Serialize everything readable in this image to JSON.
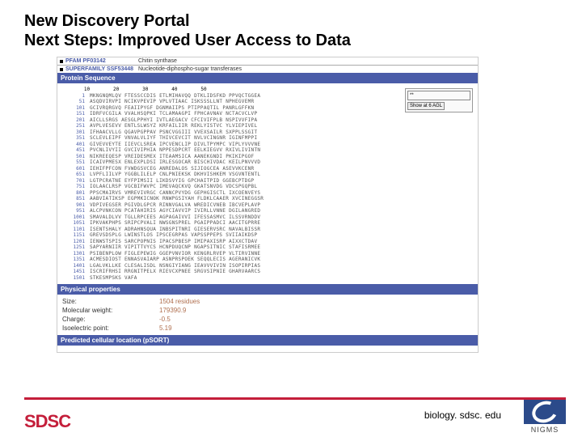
{
  "title_line1": "New Discovery Portal",
  "title_line2": "Next Steps: Improved User Access to Data",
  "header_rows": [
    {
      "label": "PFAM",
      "value": "PF03142",
      "extra": "Chitin synthase"
    },
    {
      "label": "SUPERFAMILY",
      "value": "SSF53448",
      "extra": "Nucleotide-diphospho-sugar transferases"
    }
  ],
  "seq_section_title": "Protein Sequence",
  "seq_header": "        10        20        30        40        50",
  "seq": [
    {
      "pos": "1",
      "txt": "MKNGNQMLQV FTESSCCDIS ETLMIHAVQQ DTKLIDSFKD PPVQCTGGEA"
    },
    {
      "pos": "51",
      "txt": "ASQDVIRVPI NCIKVPEVIP VPLVTIAAC ISKSSSLLNT NPHEGVEMR"
    },
    {
      "pos": "101",
      "txt": "GCIVRQRGVQ FEAIIPYGF DGNMAIIPS PTIPPAQTIL PANRLGFFKN"
    },
    {
      "pos": "151",
      "txt": "IDRFVCGILA VVALHSQPKI TCLAMAAGPI FPHCAVNAV NCTACVCLVP"
    },
    {
      "pos": "201",
      "txt": "AICLLSRGS AESGLPPHYI IVTLAEGACV CFCIVIFPLB NSPIVVFIPA"
    },
    {
      "pos": "251",
      "txt": "AVPLVESEVV ENTLSLWSYZ KRFAILIIR REKLYISTVC YLVIEPIVEL"
    },
    {
      "pos": "301",
      "txt": "IFHAACVLLG QGAVPGPPAV PSNCVGGIII VVEXSAILR SXPPLSSGIT"
    },
    {
      "pos": "351",
      "txt": "SCLEVLEIPF VNVALVLIYF THIVCEVCIT NVLVCINGNR IGINFMPPI"
    },
    {
      "pos": "401",
      "txt": "GIVEVVEYTE IIEVCLSREA IPCVENCLIP DIVLTPYMPC VIPLYVVVNE"
    },
    {
      "pos": "451",
      "txt": "PVCNLIVYII GVCIVIPHIA NPPESDPCRT EELKIEGVV RXIVLIVINTN"
    },
    {
      "pos": "501",
      "txt": "NIKREEQESP VREIDESMEX ITEAAMSICA AANEKGNDI PKIKIPGOF"
    },
    {
      "pos": "551",
      "txt": "ICAIVPMESX ENLEXPLDSI IRLESGOCAR BISCHIVDAC KEILPNVVVD"
    },
    {
      "pos": "601",
      "txt": "IEHIFPFCON FVWDGSVCEG ANREDALOS SIJIOGCEA ASEVVKCENR"
    },
    {
      "pos": "651",
      "txt": "LVPFLIILVP YGGBLILELP CNLPNIEKSK DKHVISHKEM VSGVNTENTL"
    },
    {
      "pos": "701",
      "txt": "LGTPCRATNE EYFPIMSII LIKDSVYIG GPCHAITPID GGEBCPTDGP"
    },
    {
      "pos": "751",
      "txt": "IOLAACLRSP VGCBIFWVPC IMEVAQCKVQ GKATSNVDG VDCSPGQPBL"
    },
    {
      "pos": "801",
      "txt": "PPSCMAIRVS VMREVIVRGC CANNCPVYDG GEPHGISCTL IXCOENVEYS"
    },
    {
      "pos": "851",
      "txt": "AABVIATIKSP EGPMKICNOK RNWPGSIYAH FLDKLCAAER XVCINEGGSR"
    },
    {
      "pos": "901",
      "txt": "VDPIVEGSER PGIVDLGPCR RINNVGALVA WREDICVNEB IBCVEPLAVP"
    },
    {
      "pos": "951",
      "txt": "ALCPVNKCON PCATAHIRIS AGYCIAVVIP IVIRLLVNNE DGILANGRED"
    },
    {
      "pos": "1001",
      "txt": "SMAVALDLVV TGLLRPCEES AGPAGAIVVI IFESSASMVC ILSSVRNDDV"
    },
    {
      "pos": "1051",
      "txt": "IPKVAKPHPS SRIPCPVALI NWSGNSPREL PGAIPPADCI AACITGPRRE"
    },
    {
      "pos": "1101",
      "txt": "ISENTSHALY ADRAHNSQUA INBSPITNRI GIESERVSRC NAVALBISSR"
    },
    {
      "pos": "1151",
      "txt": "GREVSDSPLG LWINSTLOS IPSCEGRPAS VAPSSPPEPS SVIIAIKDSP"
    },
    {
      "pos": "1201",
      "txt": "IENWSTSPIS SARCPOPNIS IPACSPBESP IMIPAXISRP AIXXCTDAV"
    },
    {
      "pos": "1251",
      "txt": "SAPYARNIIR VIPITTVYCS HCNPDUQCNP NGAPSITNIC STAFISRMEE"
    },
    {
      "pos": "1301",
      "txt": "PSIBENPLOW FIGLEPEWIG GGEPVNVIOR KENGRLRVEP VLTIRVINNE"
    },
    {
      "pos": "1351",
      "txt": "ACMESDIOST ENNASVAIARP ASNPRSPOEK SEQQLECIS AGERANICVK"
    },
    {
      "pos": "1401",
      "txt": "LGALVKLLKE CLESALISDL NSNGIYIANG IEAVVVIVIN ISOPIRPIAS"
    },
    {
      "pos": "1451",
      "txt": "ISCRIFRHSI RRGNITPELX RIEVCXPNEE SRGVSIPNIE GHARVAARCS"
    },
    {
      "pos": "1501",
      "txt": "STKESMPSKS VAFA"
    }
  ],
  "opt": {
    "placeholder": "**",
    "button": "Show at 6 AGL"
  },
  "props_title": "Physical properties",
  "props": [
    {
      "label": "Size:",
      "value": "1504 residues"
    },
    {
      "label": "Molecular weight:",
      "value": "179390.9"
    },
    {
      "label": "Charge:",
      "value": "-0.5"
    },
    {
      "label": "Isoelectric point:",
      "value": "5.19"
    }
  ],
  "pred_title": "Predicted cellular location (pSORT)",
  "footer": {
    "logo": "SDSC",
    "url": "biology. sdsc. edu",
    "nigms": "NIGMS"
  }
}
